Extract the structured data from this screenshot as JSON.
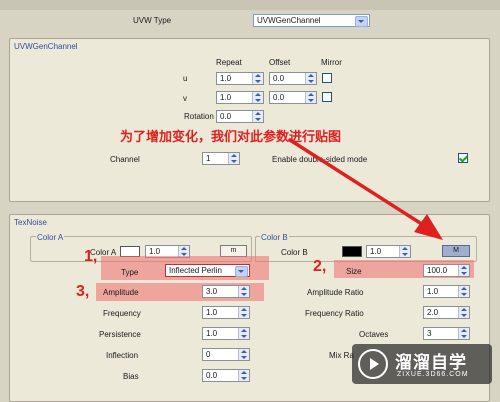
{
  "uvw_type": {
    "label": "UVW Type",
    "value": "UVWGenChannel"
  },
  "uvwgen": {
    "title": "UVWGenChannel",
    "headers": {
      "repeat": "Repeat",
      "offset": "Offset",
      "mirror": "Mirror"
    },
    "u": {
      "label": "u",
      "repeat": "1.0",
      "offset": "0.0",
      "mirror": false
    },
    "v": {
      "label": "v",
      "repeat": "1.0",
      "offset": "0.0",
      "mirror": false
    },
    "rotation": {
      "label": "Rotation",
      "value": "0.0"
    },
    "channel": {
      "label": "Channel",
      "value": "1"
    },
    "double_sided": {
      "label": "Enable double-sided mode",
      "checked": true
    }
  },
  "annotation": {
    "text": "为了增加变化，我们对此参数进行贴图",
    "step1": "1,",
    "step2": "2,",
    "step3": "3,"
  },
  "texnoise": {
    "title": "TexNoise",
    "color_a": {
      "group": "Color A",
      "label": "Color A",
      "swatch": "#ffffff",
      "value": "1.0",
      "map_button": "m"
    },
    "color_b": {
      "group": "Color B",
      "label": "Color B",
      "swatch": "#000000",
      "value": "1.0",
      "map_button": "M"
    },
    "type": {
      "label": "Type",
      "value": "Inflected Perlin"
    },
    "size": {
      "label": "Size",
      "value": "100.0"
    },
    "amplitude": {
      "label": "Amplitude",
      "value": "3.0"
    },
    "amplitude_ratio": {
      "label": "Amplitude Ratio",
      "value": "1.0"
    },
    "frequency": {
      "label": "Frequency",
      "value": "1.0"
    },
    "frequency_ratio": {
      "label": "Frequency Ratio",
      "value": "2.0"
    },
    "persistence": {
      "label": "Persistence",
      "value": "1.0"
    },
    "octaves": {
      "label": "Octaves",
      "value": "3"
    },
    "inflection": {
      "label": "Inflection",
      "value": "0"
    },
    "mix_ratio": {
      "label": "Mix Ra"
    },
    "bias": {
      "label": "Bias",
      "value": "0.0"
    }
  },
  "watermark": {
    "title": "溜溜自学",
    "url": "ZIXUE.3D66.COM"
  },
  "colors": {
    "highlight": "#f06e6e",
    "annotation": "#e02020",
    "panel_title": "#2d4fa0"
  }
}
